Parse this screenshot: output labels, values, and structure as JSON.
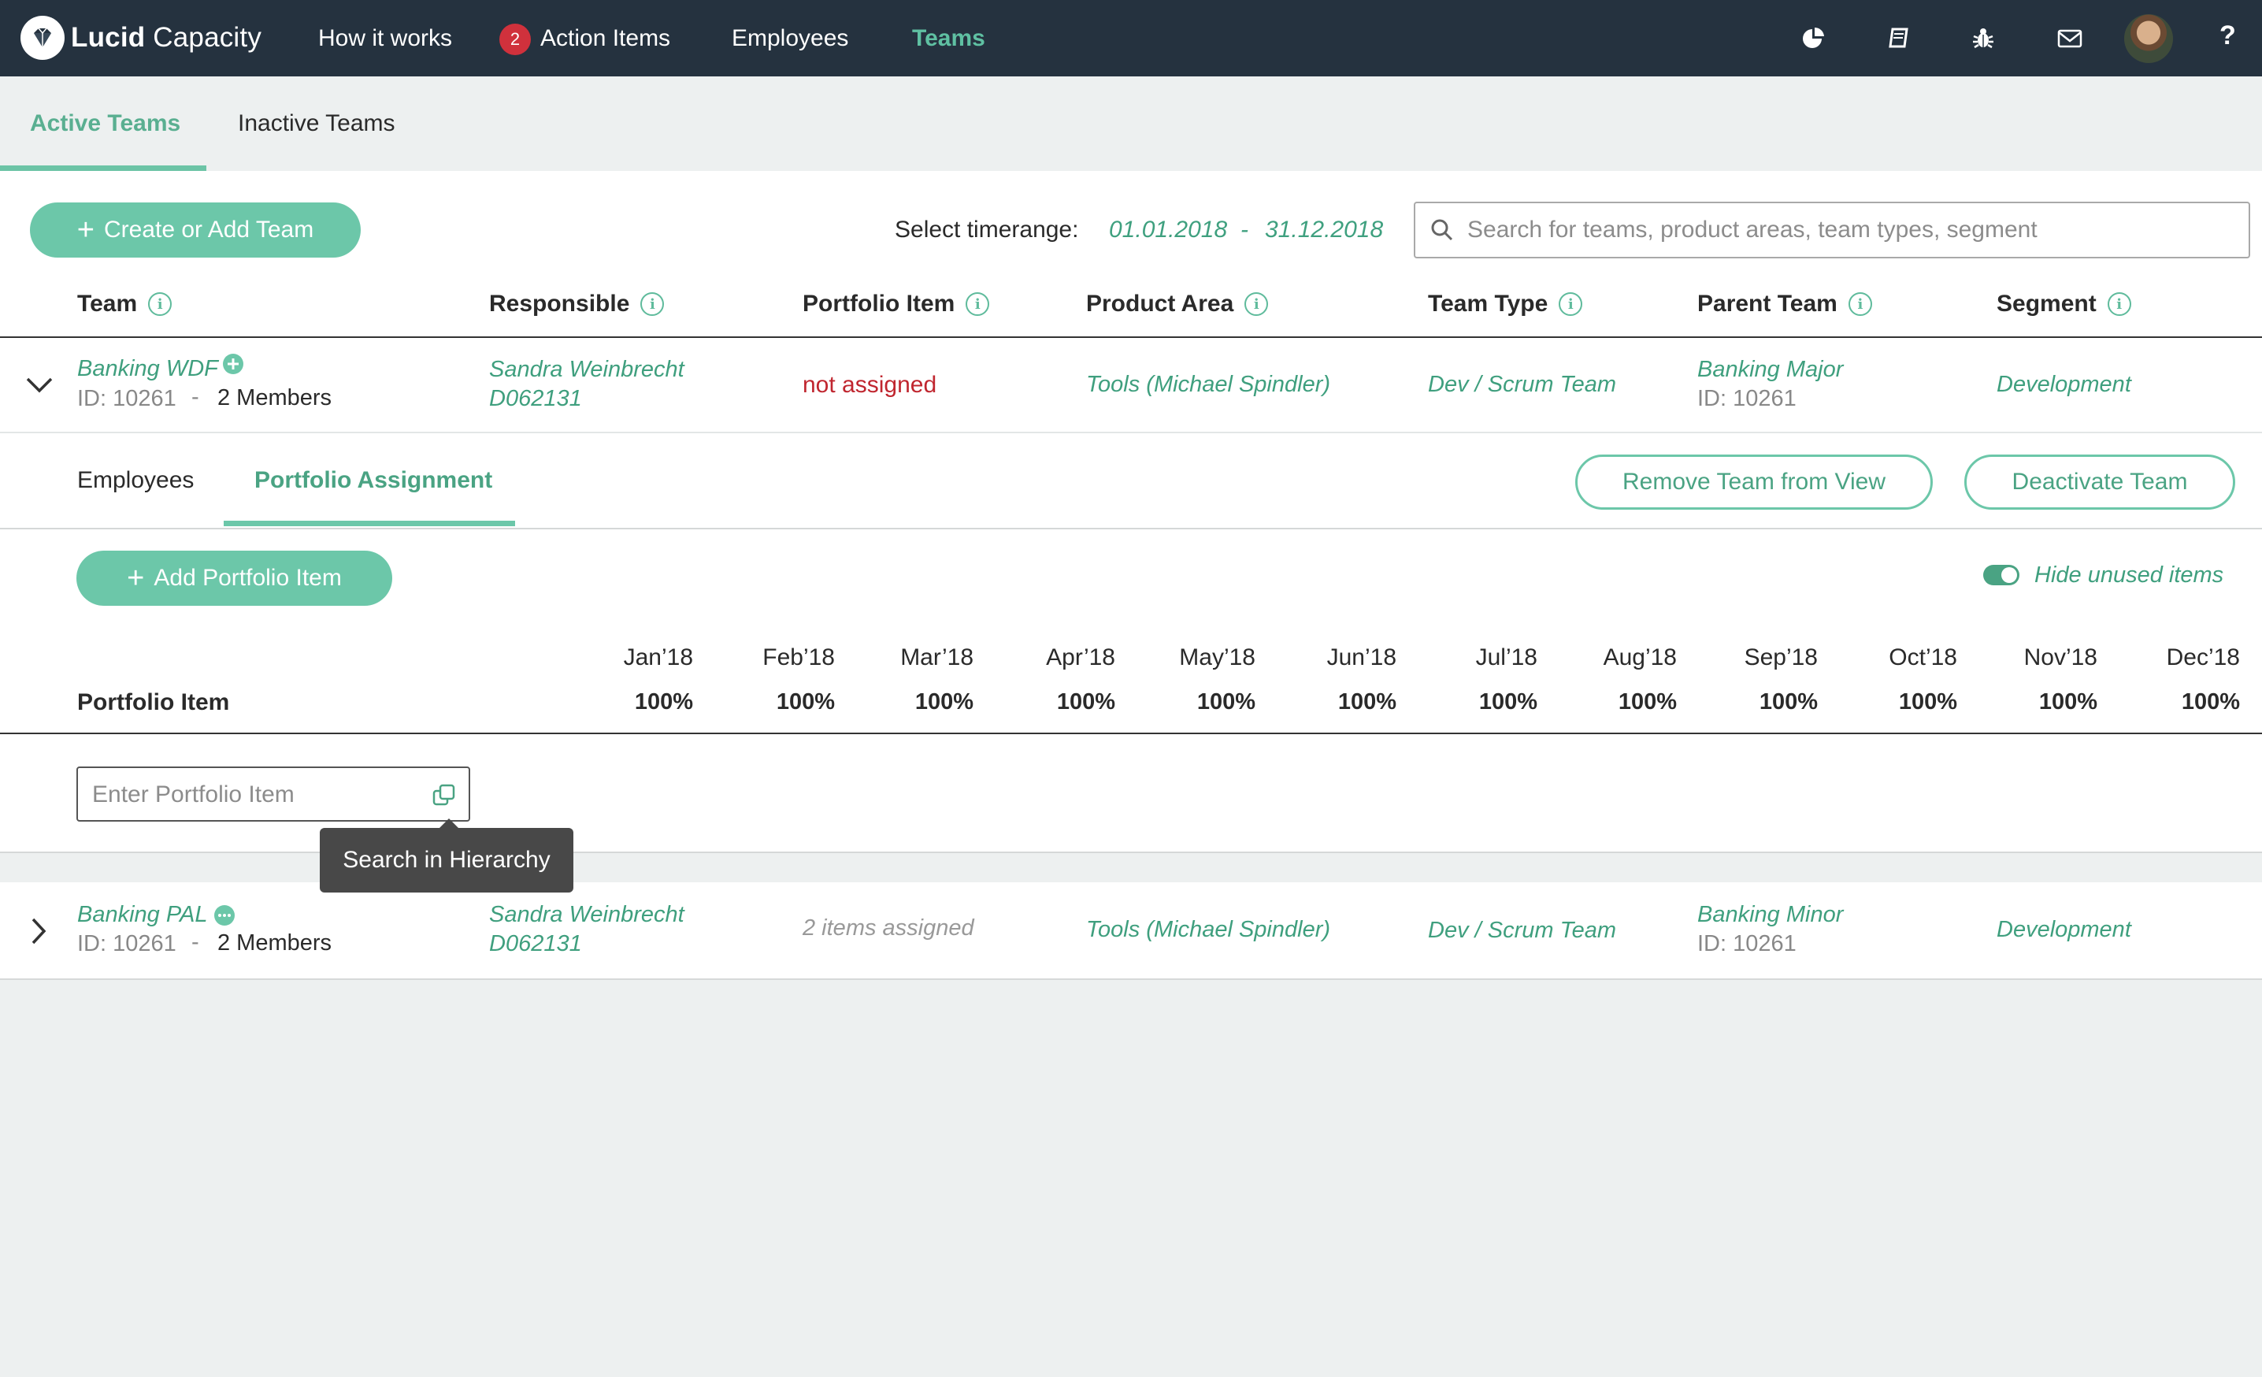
{
  "nav": {
    "brand_bold": "Lucid",
    "brand_light": "Capacity",
    "links": [
      "How it works",
      "Action Items",
      "Employees",
      "Teams"
    ],
    "action_items_count": "2",
    "icons": [
      "pie-chart-icon",
      "book-icon",
      "bug-icon",
      "mail-icon",
      "avatar",
      "help-icon"
    ],
    "help_label": "?"
  },
  "subtabs": {
    "active": "Active Teams",
    "inactive": "Inactive Teams"
  },
  "toolbar": {
    "create_button": "Create or Add Team",
    "timerange_label": "Select timerange:",
    "date_from": "01.01.2018",
    "date_sep": "-",
    "date_to": "31.12.2018",
    "search_placeholder": "Search for teams, product areas, team types, segment"
  },
  "columns": [
    "Team",
    "Responsible",
    "Portfolio Item",
    "Product Area",
    "Team Type",
    "Parent Team",
    "Segment"
  ],
  "teams": [
    {
      "name": "Banking WDF",
      "id": "ID: 10261",
      "sep": "-",
      "members": "2 Members",
      "responsible_name": "Sandra Weinbrecht",
      "responsible_id": "D062131",
      "portfolio": "not assigned",
      "product_area": "Tools (Michael Spindler)",
      "team_type": "Dev / Scrum Team",
      "parent_name": "Banking Major",
      "parent_id": "ID: 10261",
      "segment": "Development"
    },
    {
      "name": "Banking PAL",
      "id": "ID: 10261",
      "sep": "-",
      "members": "2 Members",
      "responsible_name": "Sandra Weinbrecht",
      "responsible_id": "D062131",
      "portfolio": "2 items assigned",
      "product_area": "Tools (Michael Spindler)",
      "team_type": "Dev / Scrum Team",
      "parent_name": "Banking Minor",
      "parent_id": "ID: 10261",
      "segment": "Development"
    }
  ],
  "detail": {
    "tabs": [
      "Employees",
      "Portfolio Assignment"
    ],
    "remove_button": "Remove Team from View",
    "deactivate_button": "Deactivate Team",
    "add_item_button": "Add Portfolio Item",
    "hide_unused_label": "Hide unused items",
    "hide_unused_on": true,
    "portfolio_header": "Portfolio Item",
    "months": [
      "Jan’18",
      "Feb’18",
      "Mar’18",
      "Apr’18",
      "May’18",
      "Jun’18",
      "Jul’18",
      "Aug’18",
      "Sep’18",
      "Oct’18",
      "Nov’18",
      "Dec’18"
    ],
    "percents": [
      "100%",
      "100%",
      "100%",
      "100%",
      "100%",
      "100%",
      "100%",
      "100%",
      "100%",
      "100%",
      "100%",
      "100%"
    ],
    "input_placeholder": "Enter Portfolio Item",
    "tooltip": "Search in Hierarchy"
  },
  "colors": {
    "nav_bg": "#25323f",
    "accent": "#6cc7a9",
    "accent_text": "#3f9f7e",
    "alert": "#c0262f"
  }
}
